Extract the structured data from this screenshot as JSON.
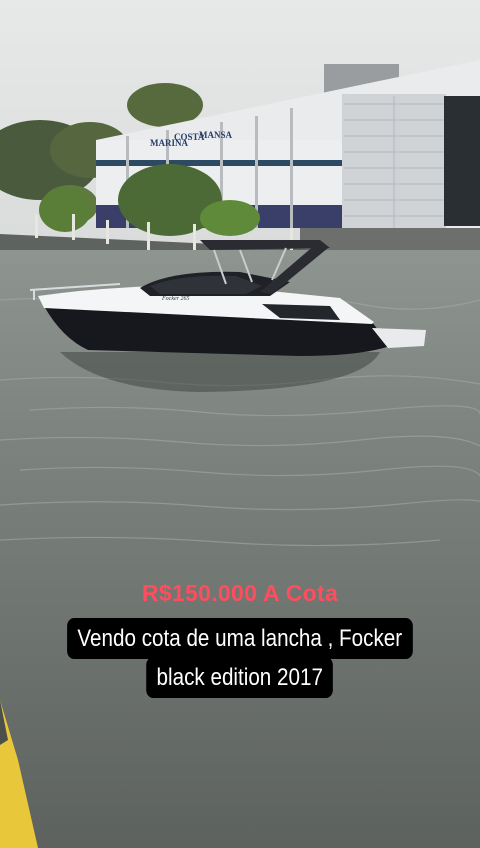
{
  "scene": {
    "description_icons": [
      "boat-image",
      "marina-building",
      "trees",
      "water"
    ],
    "building_sign": "MARINA COSTA MANSA",
    "boat_hull_lettering": "Focker 265"
  },
  "overlay": {
    "price": "R$150.000 A Cota",
    "caption_line1": "Vendo cota de uma lancha , Focker",
    "caption_line2": "black edition 2017"
  },
  "colors": {
    "price_text": "#ff4d5e",
    "caption_bg": "#000000",
    "caption_text": "#ffffff"
  }
}
